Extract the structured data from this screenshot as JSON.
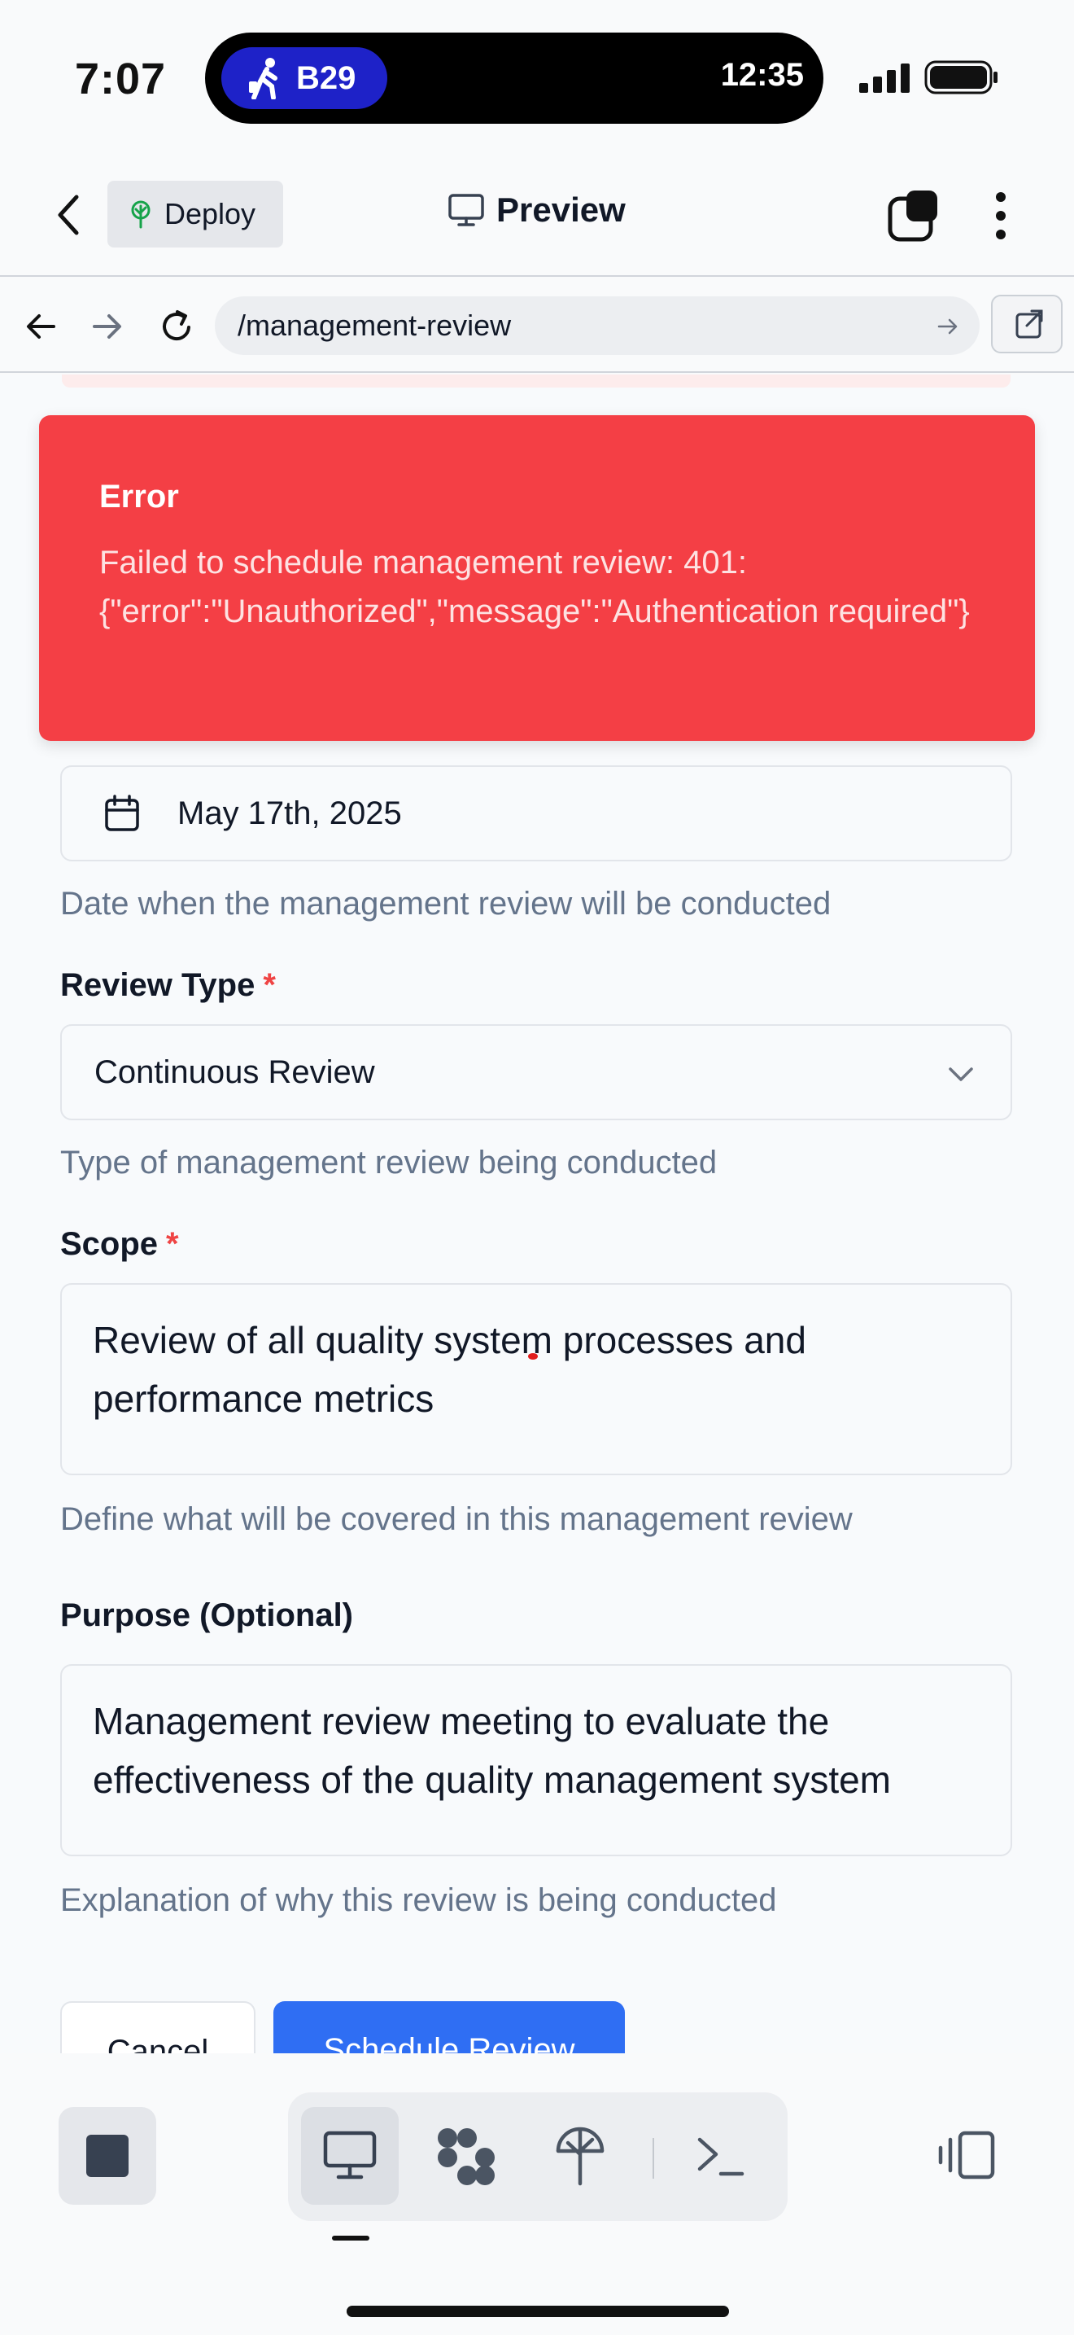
{
  "status_bar": {
    "time": "7:07",
    "transit_label": "B29",
    "island_time": "12:35"
  },
  "header": {
    "deploy_label": "Deploy",
    "title": "Preview"
  },
  "browser": {
    "url": "/management-review"
  },
  "error_toast": {
    "title": "Error",
    "message": "Failed to schedule management review: 401: {\"error\":\"Unauthorized\",\"message\":\"Authentication required\"}"
  },
  "form": {
    "date_value": "May 17th, 2025",
    "date_help": "Date when the management review will be conducted",
    "review_type_label": "Review Type",
    "review_type_value": "Continuous Review",
    "review_type_help": "Type of management review being conducted",
    "scope_label": "Scope",
    "scope_value": "Review of all quality system processes and performance metrics",
    "scope_help": "Define what will be covered in this management review",
    "purpose_label": "Purpose (Optional)",
    "purpose_value": "Management review meeting to evaluate the effectiveness of the quality management system",
    "purpose_help": "Explanation of why this review is being conducted",
    "required_marker": "*",
    "cancel_label": "Cancel",
    "submit_label": "Schedule Review"
  },
  "colors": {
    "error": "#f43f45",
    "primary": "#2f6ef3",
    "required": "#ef4444"
  }
}
